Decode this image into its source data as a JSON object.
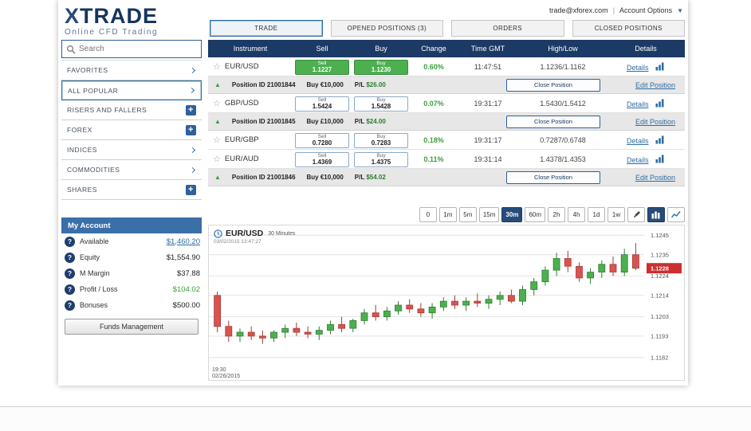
{
  "header": {
    "logo_text": "TRADE",
    "logo_x": "X",
    "tagline": "Online CFD Trading",
    "email": "trade@xforex.com",
    "separator": "|",
    "account_options_label": "Account Options"
  },
  "tabs": [
    {
      "label": "TRADE",
      "active": true
    },
    {
      "label": "OPENED POSITIONS (3)",
      "active": false
    },
    {
      "label": "ORDERS",
      "active": false
    },
    {
      "label": "CLOSED POSITIONS",
      "active": false
    }
  ],
  "sidebar": {
    "search_placeholder": "Search",
    "categories": [
      {
        "label": "FAVORITES",
        "icon": "chevron",
        "selected": false
      },
      {
        "label": "ALL POPULAR",
        "icon": "chevron",
        "selected": true
      },
      {
        "label": "RISERS AND FALLERS",
        "icon": "plus",
        "selected": false
      },
      {
        "label": "FOREX",
        "icon": "plus",
        "selected": false
      },
      {
        "label": "INDICES",
        "icon": "chevron",
        "selected": false
      },
      {
        "label": "COMMODITIES",
        "icon": "chevron",
        "selected": false
      },
      {
        "label": "SHARES",
        "icon": "plus",
        "selected": false
      }
    ],
    "account": {
      "title": "My Account",
      "rows": [
        {
          "label": "Available",
          "value": "$1,460.20",
          "style": "link"
        },
        {
          "label": "Equity",
          "value": "$1,554.90",
          "style": "normal"
        },
        {
          "label": "M Margin",
          "value": "$37.88",
          "style": "normal"
        },
        {
          "label": "Profit / Loss",
          "value": "$104.02",
          "style": "positive"
        },
        {
          "label": "Bonuses",
          "value": "$500.00",
          "style": "normal"
        }
      ],
      "funds_button_label": "Funds Management"
    }
  },
  "quotes": {
    "headers": [
      "Instrument",
      "Sell",
      "Buy",
      "Change",
      "Time GMT",
      "High/Low",
      "Details"
    ],
    "sell_label": "Sell",
    "buy_label": "Buy",
    "details_label": "Details",
    "rows": [
      {
        "instrument": "EUR/USD",
        "sell": "1.1227",
        "buy": "1.1230",
        "change": "0.60%",
        "time": "11:47:51",
        "highlow": "1.1236/1.1162",
        "button_style": "green",
        "position": {
          "id": "Position ID 21001844",
          "amount": "Buy €10,000",
          "pl_label": "P/L",
          "pl": "$26.00",
          "close_label": "Close Position",
          "edit_label": "Edit Position"
        }
      },
      {
        "instrument": "GBP/USD",
        "sell": "1.5424",
        "buy": "1.5428",
        "change": "0.07%",
        "time": "19:31:17",
        "highlow": "1.5430/1.5412",
        "button_style": "white",
        "position": {
          "id": "Position ID 21001845",
          "amount": "Buy £10,000",
          "pl_label": "P/L",
          "pl": "$24.00",
          "close_label": "Close Position",
          "edit_label": "Edit Position"
        }
      },
      {
        "instrument": "EUR/GBP",
        "sell": "0.7280",
        "buy": "0.7283",
        "change": "0.18%",
        "time": "19:31:17",
        "highlow": "0.7287/0.6748",
        "button_style": "white",
        "position": null
      },
      {
        "instrument": "EUR/AUD",
        "sell": "1.4369",
        "buy": "1.4375",
        "change": "0.11%",
        "time": "19:31:14",
        "highlow": "1.4378/1.4353",
        "button_style": "white",
        "position": {
          "id": "Position ID 21001846",
          "amount": "Buy €10,000",
          "pl_label": "P/L",
          "pl": "$54.02",
          "close_label": "Close Position",
          "edit_label": "Edit Position"
        }
      }
    ]
  },
  "chart": {
    "timeframes": [
      "0",
      "1m",
      "5m",
      "15m",
      "30m",
      "60m",
      "2h",
      "4h",
      "1d",
      "1w"
    ],
    "active_timeframe": "30m",
    "symbol": "EUR/USD",
    "interval_label": "30 Minutes",
    "timestamp": "03/02/2015 13:47:27",
    "x_axis_time": "19:30",
    "x_axis_date": "02/26/2015",
    "current_price_label": "1.1228",
    "colors": {
      "up": "#4cb04f",
      "up_border": "#2f7d33",
      "down": "#d9534f",
      "down_border": "#a63a35",
      "price_tag": "#cc2f2f",
      "grid": "#e4e4e4"
    }
  },
  "chart_data": {
    "type": "candlestick",
    "title": "EUR/USD 30 Minutes",
    "timestamp": "03/02/2015 13:47:27",
    "x_start_label": "19:30 02/26/2015",
    "y_ticks": [
      1.1245,
      1.1235,
      1.1224,
      1.1214,
      1.1203,
      1.1193,
      1.1182
    ],
    "y_range": [
      1.1179,
      1.1248
    ],
    "current_price": 1.1228,
    "candles": [
      [
        1.1214,
        1.1216,
        1.1195,
        1.1198
      ],
      [
        1.1198,
        1.1201,
        1.119,
        1.1193
      ],
      [
        1.1193,
        1.1197,
        1.119,
        1.1195
      ],
      [
        1.1195,
        1.1198,
        1.1191,
        1.1193
      ],
      [
        1.1193,
        1.1196,
        1.1189,
        1.1192
      ],
      [
        1.1192,
        1.1196,
        1.119,
        1.1195
      ],
      [
        1.1195,
        1.1199,
        1.1192,
        1.1197
      ],
      [
        1.1197,
        1.12,
        1.1193,
        1.1195
      ],
      [
        1.1195,
        1.1198,
        1.1192,
        1.1194
      ],
      [
        1.1194,
        1.1198,
        1.1191,
        1.1196
      ],
      [
        1.1196,
        1.1201,
        1.1194,
        1.1199
      ],
      [
        1.1199,
        1.1203,
        1.1195,
        1.1197
      ],
      [
        1.1197,
        1.1202,
        1.1195,
        1.1201
      ],
      [
        1.1201,
        1.1207,
        1.1199,
        1.1205
      ],
      [
        1.1205,
        1.1209,
        1.1201,
        1.1203
      ],
      [
        1.1203,
        1.1208,
        1.1201,
        1.1206
      ],
      [
        1.1206,
        1.1211,
        1.1204,
        1.1209
      ],
      [
        1.1209,
        1.1212,
        1.1205,
        1.1207
      ],
      [
        1.1207,
        1.121,
        1.1203,
        1.1205
      ],
      [
        1.1205,
        1.121,
        1.1202,
        1.1208
      ],
      [
        1.1208,
        1.1213,
        1.1206,
        1.1211
      ],
      [
        1.1211,
        1.1214,
        1.1207,
        1.1209
      ],
      [
        1.1209,
        1.1213,
        1.1206,
        1.1211
      ],
      [
        1.1211,
        1.1215,
        1.1208,
        1.121
      ],
      [
        1.121,
        1.1214,
        1.1207,
        1.1212
      ],
      [
        1.1212,
        1.1216,
        1.1209,
        1.1214
      ],
      [
        1.1214,
        1.1217,
        1.121,
        1.1211
      ],
      [
        1.1211,
        1.1219,
        1.1209,
        1.1217
      ],
      [
        1.1217,
        1.1223,
        1.1214,
        1.1221
      ],
      [
        1.1221,
        1.1229,
        1.1219,
        1.1227
      ],
      [
        1.1227,
        1.1236,
        1.1224,
        1.1233
      ],
      [
        1.1233,
        1.1237,
        1.1226,
        1.1229
      ],
      [
        1.1229,
        1.1231,
        1.1221,
        1.1223
      ],
      [
        1.1223,
        1.1228,
        1.122,
        1.1226
      ],
      [
        1.1226,
        1.1232,
        1.1223,
        1.123
      ],
      [
        1.123,
        1.1234,
        1.1224,
        1.1226
      ],
      [
        1.1226,
        1.1238,
        1.1224,
        1.1235
      ],
      [
        1.1235,
        1.1241,
        1.1227,
        1.1228
      ]
    ]
  }
}
